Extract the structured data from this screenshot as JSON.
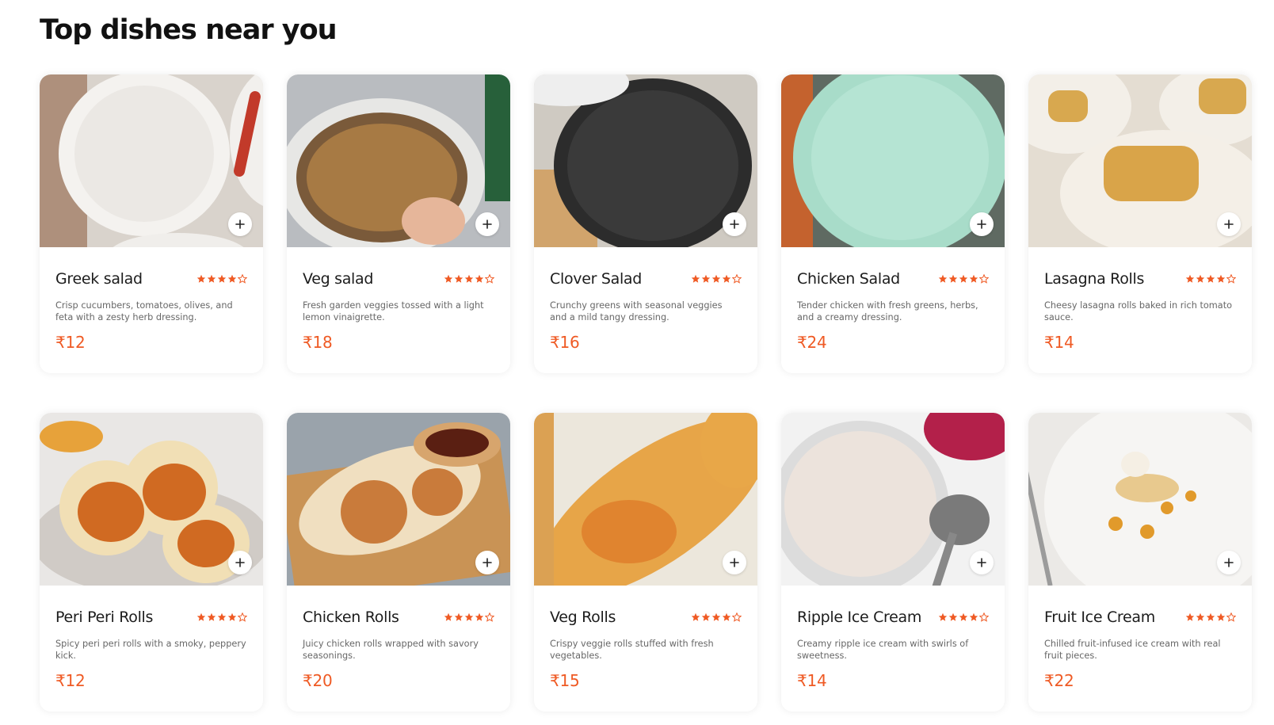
{
  "section": {
    "title": "Top dishes near you"
  },
  "colors": {
    "accent": "#ef5a24",
    "star": "#ef5a24",
    "card_bg": "#ffffff",
    "text_muted": "#676767"
  },
  "dishes": [
    {
      "name": "Greek salad",
      "description": "Crisp cucumbers, tomatoes, olives, and feta with a zesty herb dressing.",
      "price": "₹12",
      "rating": 4,
      "image_icon": "greek-salad-photo"
    },
    {
      "name": "Veg salad",
      "description": "Fresh garden veggies tossed with a light lemon vinaigrette.",
      "price": "₹18",
      "rating": 4,
      "image_icon": "veg-salad-photo"
    },
    {
      "name": "Clover Salad",
      "description": "Crunchy greens with seasonal veggies and a mild tangy dressing.",
      "price": "₹16",
      "rating": 4,
      "image_icon": "clover-salad-photo"
    },
    {
      "name": "Chicken Salad",
      "description": "Tender chicken with fresh greens, herbs, and a creamy dressing.",
      "price": "₹24",
      "rating": 4,
      "image_icon": "chicken-salad-photo"
    },
    {
      "name": "Lasagna Rolls",
      "description": "Cheesy lasagna rolls baked in rich tomato sauce.",
      "price": "₹14",
      "rating": 4,
      "image_icon": "lasagna-rolls-photo"
    },
    {
      "name": "Peri Peri Rolls",
      "description": "Spicy peri peri rolls with a smoky, peppery kick.",
      "price": "₹12",
      "rating": 4,
      "image_icon": "peri-peri-rolls-photo"
    },
    {
      "name": "Chicken Rolls",
      "description": "Juicy chicken rolls wrapped with savory seasonings.",
      "price": "₹20",
      "rating": 4,
      "image_icon": "chicken-rolls-photo"
    },
    {
      "name": "Veg Rolls",
      "description": "Crispy veggie rolls stuffed with fresh vegetables.",
      "price": "₹15",
      "rating": 4,
      "image_icon": "veg-rolls-photo"
    },
    {
      "name": "Ripple Ice Cream",
      "description": "Creamy ripple ice cream with swirls of sweetness.",
      "price": "₹14",
      "rating": 4,
      "image_icon": "ripple-ice-cream-photo"
    },
    {
      "name": "Fruit Ice Cream",
      "description": "Chilled fruit-infused ice cream with real fruit pieces.",
      "price": "₹22",
      "rating": 4,
      "image_icon": "fruit-ice-cream-photo"
    }
  ]
}
